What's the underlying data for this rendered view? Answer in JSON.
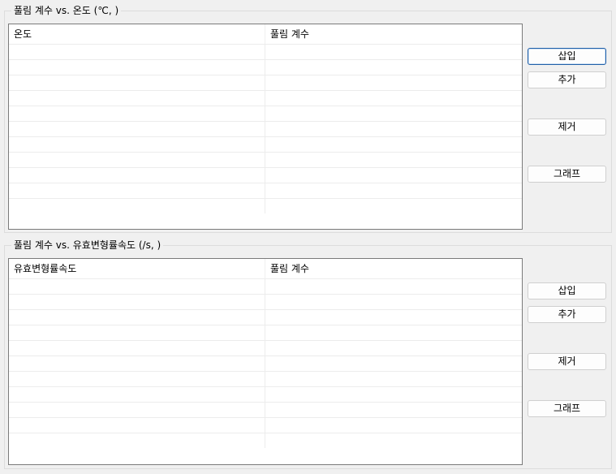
{
  "groups": [
    {
      "title": "풀림 계수 vs. 온도 (℃, )",
      "columns": [
        "온도",
        "풀림 계수"
      ],
      "rows": [
        [
          "",
          ""
        ],
        [
          "",
          ""
        ],
        [
          "",
          ""
        ],
        [
          "",
          ""
        ],
        [
          "",
          ""
        ],
        [
          "",
          ""
        ],
        [
          "",
          ""
        ],
        [
          "",
          ""
        ],
        [
          "",
          ""
        ],
        [
          "",
          ""
        ],
        [
          "",
          ""
        ]
      ],
      "buttons": {
        "insert": "삽입",
        "add": "추가",
        "remove": "제거",
        "graph": "그래프"
      }
    },
    {
      "title": "풀림 계수 vs. 유효변형률속도 (/s, )",
      "columns": [
        "유효변형률속도",
        "풀림 계수"
      ],
      "rows": [
        [
          "",
          ""
        ],
        [
          "",
          ""
        ],
        [
          "",
          ""
        ],
        [
          "",
          ""
        ],
        [
          "",
          ""
        ],
        [
          "",
          ""
        ],
        [
          "",
          ""
        ],
        [
          "",
          ""
        ],
        [
          "",
          ""
        ],
        [
          "",
          ""
        ],
        [
          "",
          ""
        ]
      ],
      "buttons": {
        "insert": "삽입",
        "add": "추가",
        "remove": "제거",
        "graph": "그래프"
      }
    }
  ]
}
